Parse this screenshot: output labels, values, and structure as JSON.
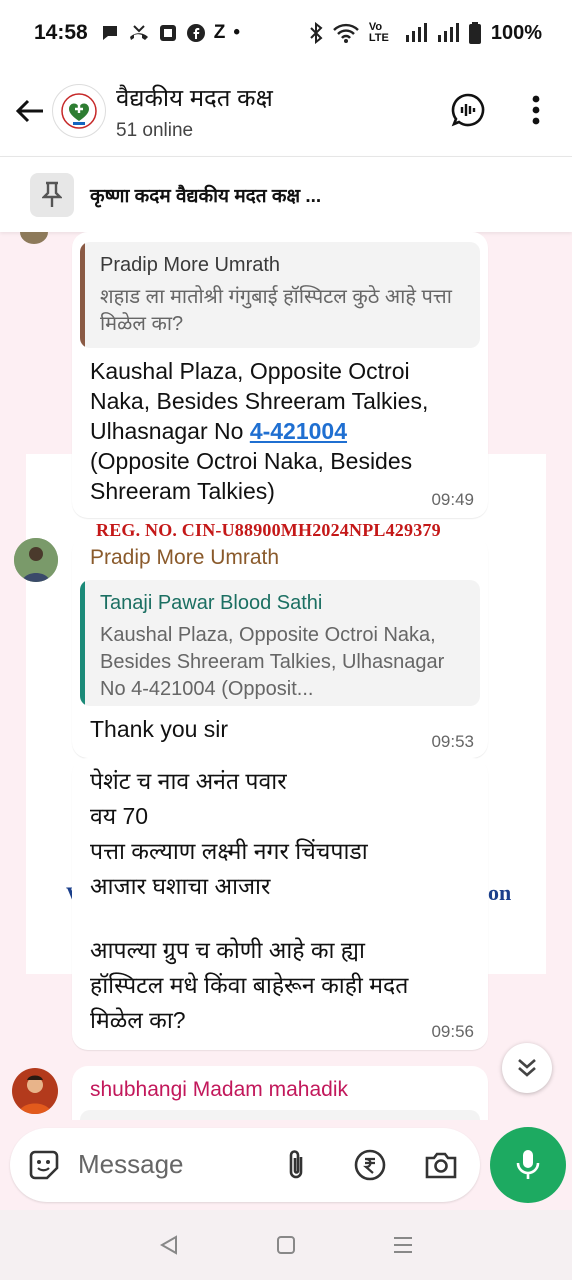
{
  "status_bar": {
    "time": "14:58",
    "letter": "Z",
    "dot": "•",
    "network": "Vo LTE",
    "battery": "100%"
  },
  "header": {
    "group_name": "वैद्यकीय मदत कक्ष",
    "online": "51 online"
  },
  "pinned": {
    "text": "कृष्णा कदम वैद्यकीय मदत कक्ष ..."
  },
  "wallpaper": {
    "reg_text": "REG. NO. CIN-U88900MH2024NPL429379",
    "tail_text": "on",
    "lead_text": "V"
  },
  "messages": [
    {
      "quote_name": "Pradip More Umrath",
      "quote_text": "शहाड ला मातोश्री गंगुबाई हॉस्पिटल कुठे आहे पत्ता मिळेल का?",
      "line1": "Kaushal Plaza, Opposite Octroi",
      "line2": "Naka, Besides Shreeram Talkies,",
      "line3_prefix": "Ulhasnagar No ",
      "line3_link": "4-421004",
      "line4": "(Opposite Octroi Naka, Besides",
      "line5": "Shreeram Talkies)",
      "time": "09:49"
    },
    {
      "sender": "Pradip More Umrath",
      "quote_name": "Tanaji Pawar Blood Sathi",
      "quote_text": "Kaushal Plaza, Opposite Octroi Naka, Besides Shreeram Talkies, Ulhasnagar No 4-421004 (Opposit...",
      "text": "Thank you sir",
      "time": "09:53"
    },
    {
      "line1": "पेशंट च नाव अनंत पवार",
      "line2": "वय 70",
      "line3": "पत्ता कल्याण लक्ष्मी नगर चिंचपाडा",
      "line4": "आजार घशाचा आजार",
      "line5": "आपल्या ग्रुप च कोणी आहे का ह्या",
      "line6": "हॉस्पिटल मधे किंवा बाहेरून काही मदत",
      "line7": "मिळेल का?",
      "time": "09:56"
    },
    {
      "sender": "shubhangi Madam mahadik"
    }
  ],
  "composer": {
    "placeholder": "Message"
  },
  "colors": {
    "accent_green": "#1daa61",
    "quote_bar_brown": "#8a5a44",
    "quote_bar_teal": "#1b8a78",
    "sender_brown": "#8a5a2b",
    "sender_pink": "#c2185b",
    "link_blue": "#1f6fd1"
  }
}
